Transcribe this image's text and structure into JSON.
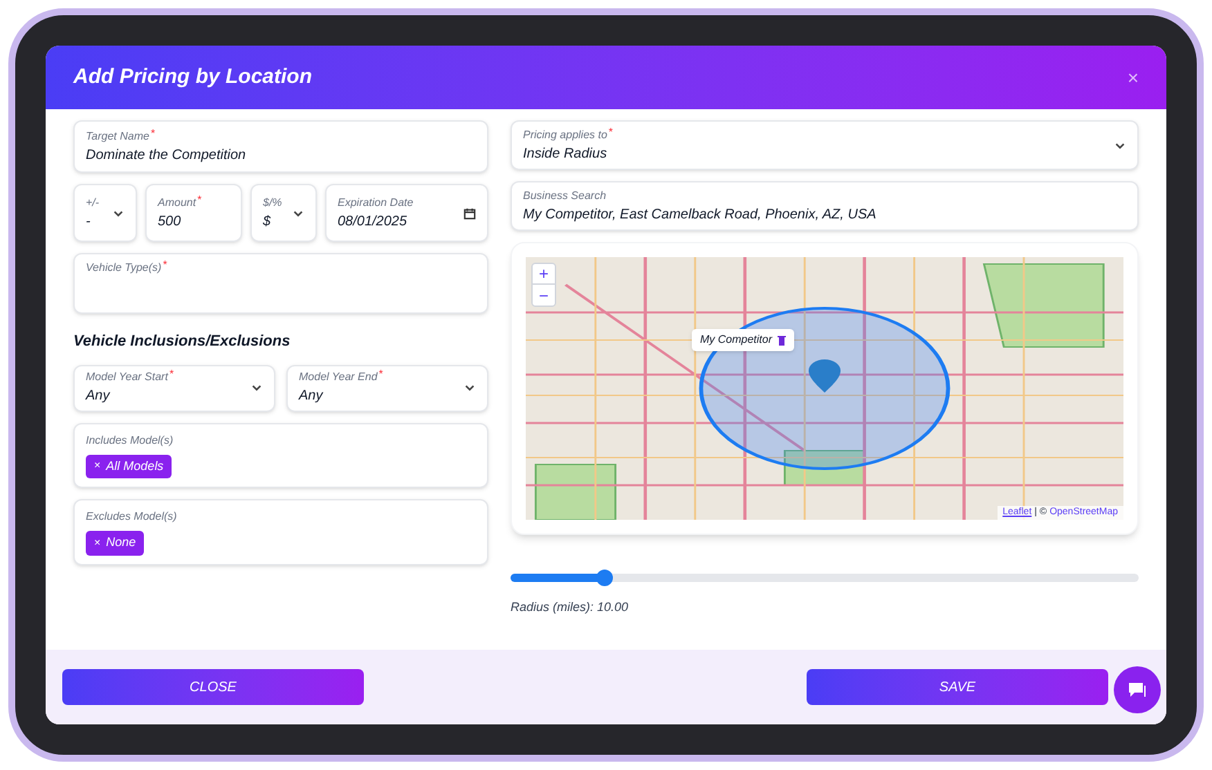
{
  "dialog": {
    "title": "Add Pricing by Location",
    "close_icon": "×"
  },
  "left": {
    "target_name": {
      "label": "Target Name",
      "required_mark": "*",
      "value": "Dominate the Competition"
    },
    "sign": {
      "label": "+/-",
      "value": "-"
    },
    "amount": {
      "label": "Amount",
      "required_mark": "*",
      "value": "500"
    },
    "unit": {
      "label": "$/%",
      "value": "$"
    },
    "expiration": {
      "label": "Expiration Date",
      "value": "08/01/2025"
    },
    "vehicle_types": {
      "label": "Vehicle Type(s)",
      "required_mark": "*"
    },
    "section_heading": "Vehicle Inclusions/Exclusions",
    "year_start": {
      "label": "Model Year Start",
      "required_mark": "*",
      "value": "Any"
    },
    "year_end": {
      "label": "Model Year End",
      "required_mark": "*",
      "value": "Any"
    },
    "includes": {
      "label": "Includes Model(s)",
      "chips": [
        {
          "close": "×",
          "text": "All Models"
        }
      ]
    },
    "excludes": {
      "label": "Excludes Model(s)",
      "chips": [
        {
          "close": "×",
          "text": "None"
        }
      ]
    }
  },
  "right": {
    "applies_to": {
      "label": "Pricing applies to",
      "required_mark": "*",
      "value": "Inside Radius"
    },
    "business_search": {
      "label": "Business Search",
      "value": "My Competitor, East Camelback Road, Phoenix, AZ, USA"
    },
    "map": {
      "zoom_in": "+",
      "zoom_out": "−",
      "popup": "My Competitor",
      "attribution_link": "Leaflet",
      "attribution_text": "| ©",
      "attribution_osm": "OpenStreetMap"
    },
    "radius_slider": {
      "level": 0.15
    },
    "radius_reading": "Radius (miles): 10.00"
  },
  "footer": {
    "buttons": [
      {
        "kind": "close",
        "label": "CLOSE"
      },
      {
        "kind": "save",
        "label": "SAVE"
      }
    ]
  }
}
